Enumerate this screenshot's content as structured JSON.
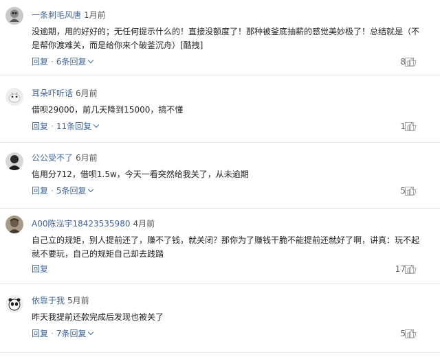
{
  "comments": [
    {
      "username": "一条刺毛风唐",
      "time": "1月前",
      "text": "没逾期，用的好好的；无任何提示什么的！直接没额度了！那种被釜底抽薪的感觉美妙极了！总结就是（不是帮你渡难关，而是给你来个破釜沉舟）[酷拽]",
      "reply_label": "回复",
      "replies_label": "6条回复",
      "likes": "8",
      "avatar_color": "#c9c9c9"
    },
    {
      "username": "耳朵吓听话",
      "time": "6月前",
      "text": "借呗29000，前几天降到15000，搞不懂",
      "reply_label": "回复",
      "replies_label": "11条回复",
      "likes": "1",
      "avatar_color": "#e8e8e8"
    },
    {
      "username": "公公受不了",
      "time": "6月前",
      "text": "信用分712，借呗1.5w，今天一看突然给我关了，从未逾期",
      "reply_label": "回复",
      "replies_label": "5条回复",
      "likes": "5",
      "avatar_color": "#2b2b2b"
    },
    {
      "username": "A00陈泓宇18423535980",
      "time": "4月前",
      "text": "自己立的规矩，别人提前还了，赚不了钱，就关闭？那你为了赚钱干脆不能提前还就好了啊，讲真：玩不起就不要玩，自己的规矩自己却去践踏",
      "reply_label": "回复",
      "replies_label": "",
      "likes": "17",
      "avatar_color": "#7a6a5a"
    },
    {
      "username": "依靠于我",
      "time": "5月前",
      "text": "昨天我提前还款完成后发现也被关了",
      "reply_label": "回复",
      "replies_label": "7条回复",
      "likes": "5",
      "avatar_color": "#dcdcdc"
    }
  ],
  "colors": {
    "link": "#406599",
    "meta_gray": "#555555",
    "divider": "#e6e6e6"
  },
  "icons": [
    "avatar",
    "chevron-down-icon",
    "thumbs-up-icon",
    "report-icon"
  ]
}
